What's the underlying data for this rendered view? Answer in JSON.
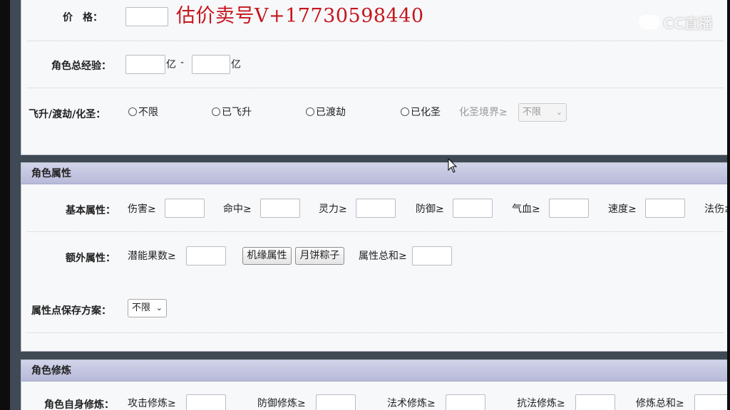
{
  "overlay": {
    "watermark": "估价卖号V+17730598440",
    "logo_text": "CC直播"
  },
  "panel1": {
    "price_label": "价　格：",
    "exp_label": "角色总经验：",
    "exp_unit": "亿",
    "exp_separator": "-",
    "ascend_label": "飞升/渡劫/化圣：",
    "ascend_options": [
      "不限",
      "已飞升",
      "已渡劫",
      "已化圣"
    ],
    "realm_label": "化圣境界≥",
    "realm_select": "不限"
  },
  "panel2": {
    "title": "角色属性",
    "basic_label": "基本属性：",
    "basic_fields": [
      "伤害≥",
      "命中≥",
      "灵力≥",
      "防御≥",
      "气血≥",
      "速度≥",
      "法伤≥"
    ],
    "extra_label": "额外属性：",
    "potential_label": "潜能果数≥",
    "btn_jiyuan": "机缘属性",
    "btn_mooncake": "月饼粽子",
    "attr_total_label": "属性总和≥",
    "scheme_label": "属性点保存方案：",
    "scheme_select": "不限"
  },
  "panel3": {
    "title": "角色修炼",
    "self_label": "角色自身修炼：",
    "fields": [
      "攻击修炼≥",
      "防御修炼≥",
      "法术修炼≥",
      "抗法修炼≥",
      "修炼总和≥"
    ]
  }
}
